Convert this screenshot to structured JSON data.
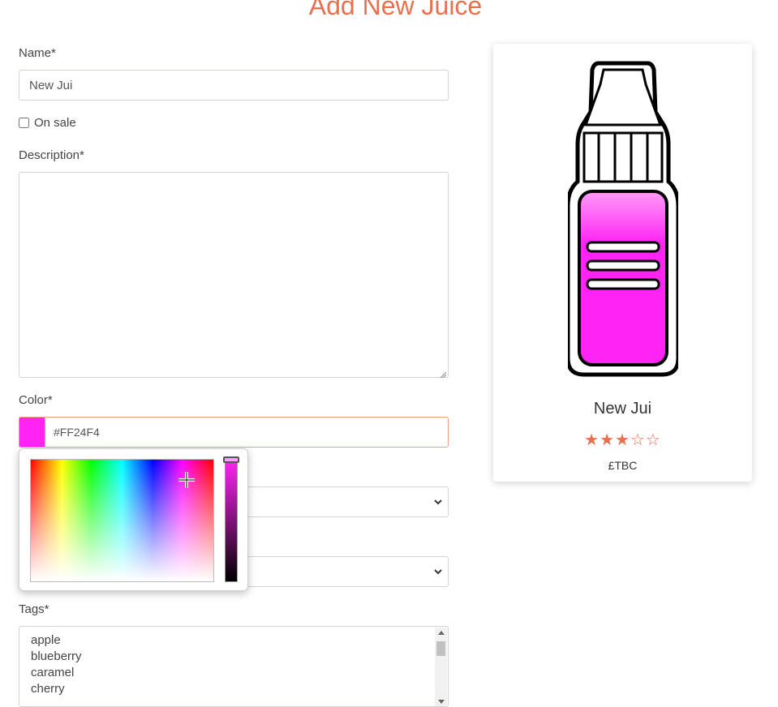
{
  "page": {
    "title": "Add New Juice"
  },
  "form": {
    "name": {
      "label": "Name*",
      "value": "New Jui"
    },
    "on_sale": {
      "label": "On sale",
      "checked": false
    },
    "description": {
      "label": "Description*",
      "value": ""
    },
    "color": {
      "label": "Color*",
      "value": "#FF24F4",
      "swatch": "#FF24F4"
    },
    "tags": {
      "label": "Tags*",
      "options": [
        "apple",
        "blueberry",
        "caramel",
        "cherry"
      ]
    }
  },
  "color_picker": {
    "hue_color": "#ff24f4"
  },
  "preview_card": {
    "name": "New Jui",
    "rating": {
      "value": 3,
      "max": 5
    },
    "stars_text": "★★★☆☆",
    "price": "£TBC",
    "bottle_fill_color": "#ff24f4"
  },
  "colors": {
    "accent": "#e8704f"
  }
}
